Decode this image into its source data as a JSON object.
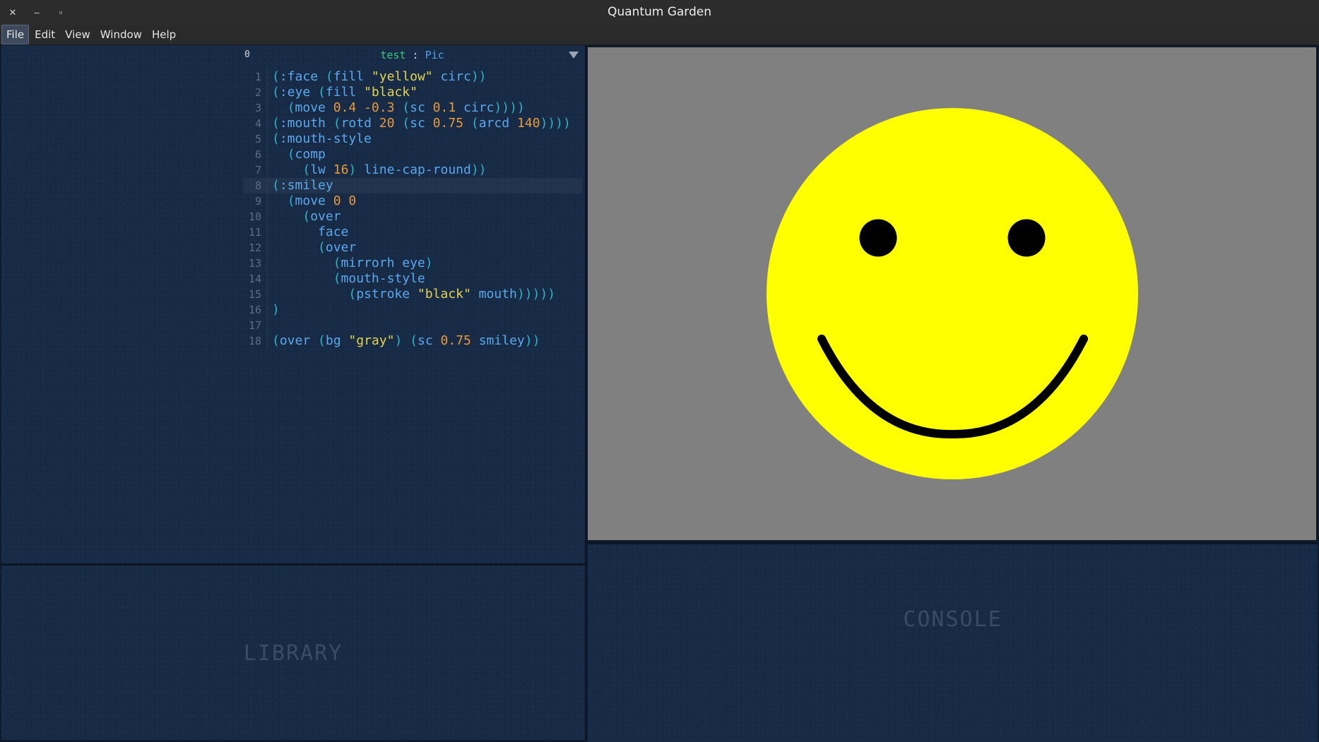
{
  "window": {
    "title": "Quantum Garden",
    "controls": {
      "close": "✕",
      "minimize": "–",
      "maximize": "▫"
    }
  },
  "menubar": {
    "items": [
      "File",
      "Edit",
      "View",
      "Window",
      "Help"
    ],
    "active": "File"
  },
  "editor": {
    "index": "0",
    "name": "test",
    "separator": ":",
    "type": "Pic",
    "current_line": 8,
    "lines": [
      [
        [
          "paren",
          "("
        ],
        [
          "kw",
          ":face"
        ],
        [
          "plain",
          " "
        ],
        [
          "paren",
          "("
        ],
        [
          "sym",
          "fill"
        ],
        [
          "plain",
          " "
        ],
        [
          "str",
          "\"yellow\""
        ],
        [
          "plain",
          " "
        ],
        [
          "sym",
          "circ"
        ],
        [
          "paren",
          "))"
        ]
      ],
      [
        [
          "paren",
          "("
        ],
        [
          "kw",
          ":eye"
        ],
        [
          "plain",
          " "
        ],
        [
          "paren",
          "("
        ],
        [
          "sym",
          "fill"
        ],
        [
          "plain",
          " "
        ],
        [
          "str",
          "\"black\""
        ]
      ],
      [
        [
          "plain",
          "  "
        ],
        [
          "paren",
          "("
        ],
        [
          "sym",
          "move"
        ],
        [
          "plain",
          " "
        ],
        [
          "num",
          "0.4"
        ],
        [
          "plain",
          " "
        ],
        [
          "num",
          "-0.3"
        ],
        [
          "plain",
          " "
        ],
        [
          "paren",
          "("
        ],
        [
          "sym",
          "sc"
        ],
        [
          "plain",
          " "
        ],
        [
          "num",
          "0.1"
        ],
        [
          "plain",
          " "
        ],
        [
          "sym",
          "circ"
        ],
        [
          "paren",
          "))))"
        ]
      ],
      [
        [
          "paren",
          "("
        ],
        [
          "kw",
          ":mouth"
        ],
        [
          "plain",
          " "
        ],
        [
          "paren",
          "("
        ],
        [
          "sym",
          "rotd"
        ],
        [
          "plain",
          " "
        ],
        [
          "num",
          "20"
        ],
        [
          "plain",
          " "
        ],
        [
          "paren",
          "("
        ],
        [
          "sym",
          "sc"
        ],
        [
          "plain",
          " "
        ],
        [
          "num",
          "0.75"
        ],
        [
          "plain",
          " "
        ],
        [
          "paren",
          "("
        ],
        [
          "sym",
          "arcd"
        ],
        [
          "plain",
          " "
        ],
        [
          "num",
          "140"
        ],
        [
          "paren",
          "))))"
        ]
      ],
      [
        [
          "paren",
          "("
        ],
        [
          "kw",
          ":mouth-style"
        ]
      ],
      [
        [
          "plain",
          "  "
        ],
        [
          "paren",
          "("
        ],
        [
          "sym",
          "comp"
        ]
      ],
      [
        [
          "plain",
          "    "
        ],
        [
          "paren",
          "("
        ],
        [
          "sym",
          "lw"
        ],
        [
          "plain",
          " "
        ],
        [
          "num",
          "16"
        ],
        [
          "paren",
          ")"
        ],
        [
          "plain",
          " "
        ],
        [
          "sym",
          "line-cap-round"
        ],
        [
          "paren",
          "))"
        ]
      ],
      [
        [
          "paren",
          "("
        ],
        [
          "kw",
          ":smiley"
        ]
      ],
      [
        [
          "plain",
          "  "
        ],
        [
          "paren",
          "("
        ],
        [
          "sym",
          "move"
        ],
        [
          "plain",
          " "
        ],
        [
          "num",
          "0"
        ],
        [
          "plain",
          " "
        ],
        [
          "num",
          "0"
        ]
      ],
      [
        [
          "plain",
          "    "
        ],
        [
          "paren",
          "("
        ],
        [
          "sym",
          "over"
        ]
      ],
      [
        [
          "plain",
          "      "
        ],
        [
          "sym",
          "face"
        ]
      ],
      [
        [
          "plain",
          "      "
        ],
        [
          "paren",
          "("
        ],
        [
          "sym",
          "over"
        ]
      ],
      [
        [
          "plain",
          "        "
        ],
        [
          "paren",
          "("
        ],
        [
          "sym",
          "mirrorh"
        ],
        [
          "plain",
          " "
        ],
        [
          "sym",
          "eye"
        ],
        [
          "paren",
          ")"
        ]
      ],
      [
        [
          "plain",
          "        "
        ],
        [
          "paren",
          "("
        ],
        [
          "sym",
          "mouth-style"
        ]
      ],
      [
        [
          "plain",
          "          "
        ],
        [
          "paren",
          "("
        ],
        [
          "sym",
          "pstroke"
        ],
        [
          "plain",
          " "
        ],
        [
          "str",
          "\"black\""
        ],
        [
          "plain",
          " "
        ],
        [
          "sym",
          "mouth"
        ],
        [
          "paren",
          ")))))"
        ]
      ],
      [
        [
          "paren",
          ")"
        ]
      ],
      [],
      [
        [
          "paren",
          "("
        ],
        [
          "sym",
          "over"
        ],
        [
          "plain",
          " "
        ],
        [
          "paren",
          "("
        ],
        [
          "sym",
          "bg"
        ],
        [
          "plain",
          " "
        ],
        [
          "str",
          "\"gray\""
        ],
        [
          "paren",
          ")"
        ],
        [
          "plain",
          " "
        ],
        [
          "paren",
          "("
        ],
        [
          "sym",
          "sc"
        ],
        [
          "plain",
          " "
        ],
        [
          "num",
          "0.75"
        ],
        [
          "plain",
          " "
        ],
        [
          "sym",
          "smiley"
        ],
        [
          "paren",
          "))"
        ]
      ]
    ]
  },
  "preview": {
    "background": "#808080",
    "face_color": "#ffff00",
    "feature_color": "#000000"
  },
  "library": {
    "label": "LIBRARY"
  },
  "console": {
    "label": "CONSOLE"
  },
  "colors": {
    "pane_bg": "#172a46",
    "paren": "#2fb4c8",
    "symbol": "#5aa9ee",
    "string": "#e3d552",
    "number": "#e99a3c",
    "header_name": "#3ec97a"
  }
}
